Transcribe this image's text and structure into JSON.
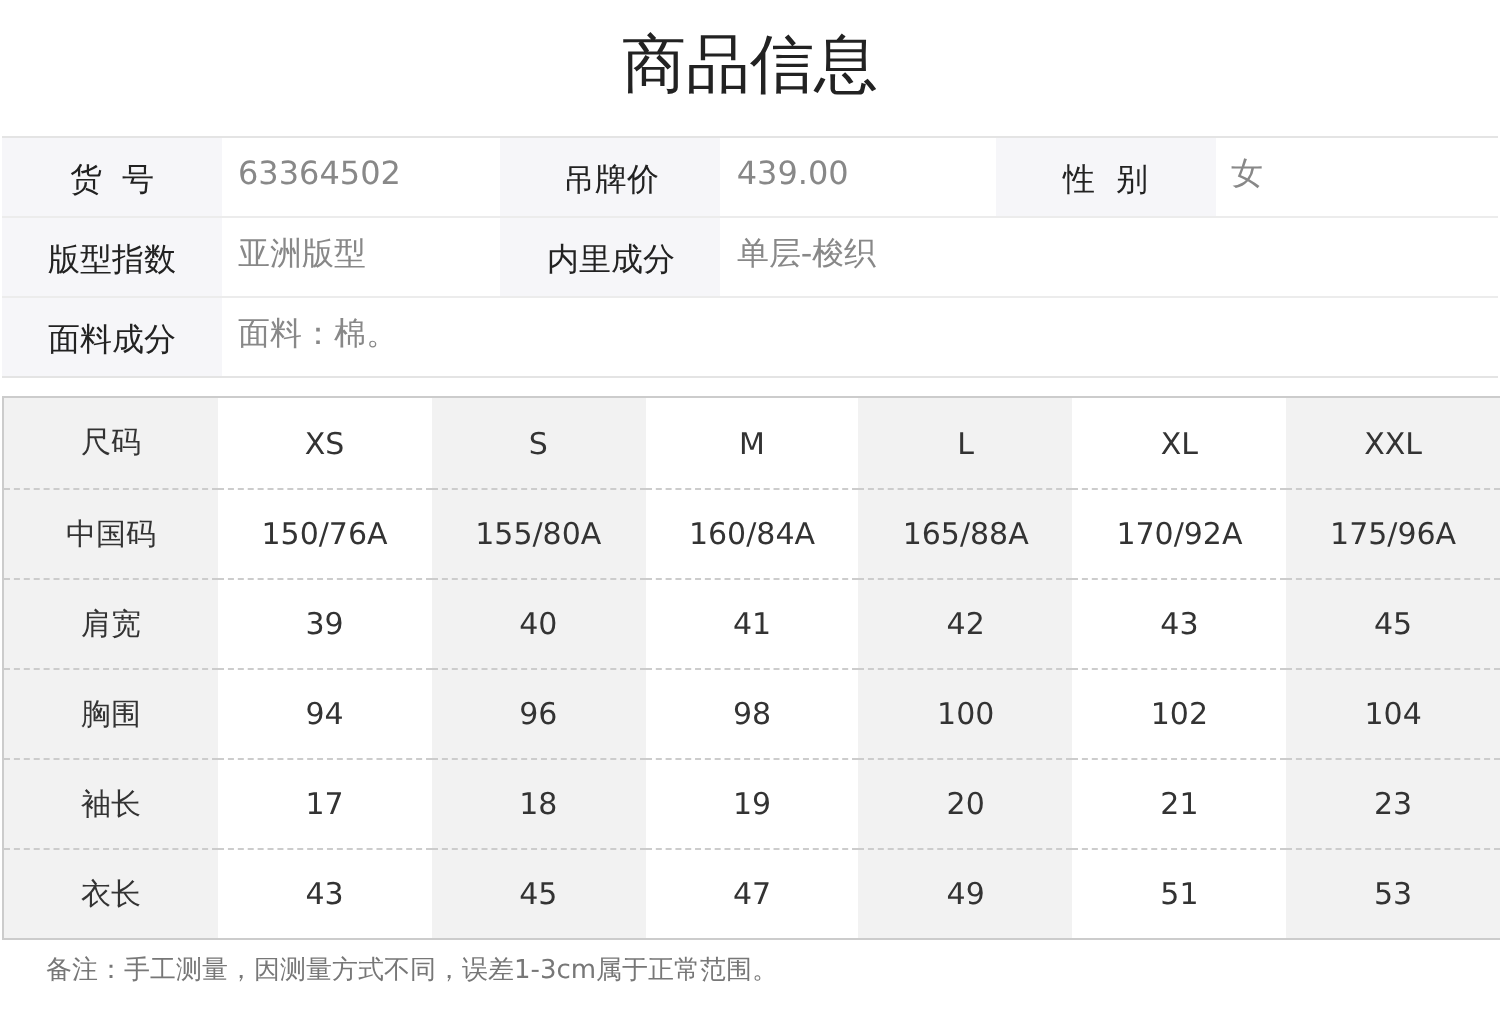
{
  "title": "商品信息",
  "info_rows": [
    {
      "fields": [
        {
          "label": "货  号",
          "value": "63364502"
        },
        {
          "label": "吊牌价",
          "value": "439.00"
        },
        {
          "label": "性  别",
          "value": "女"
        }
      ]
    },
    {
      "fields": [
        {
          "label": "版型指数",
          "value": "亚洲版型"
        },
        {
          "label": "内里成分",
          "value": "单层-梭织"
        }
      ]
    },
    {
      "fields": [
        {
          "label": "面料成分",
          "value": "面料：棉。"
        }
      ]
    }
  ],
  "size_table": {
    "columns": [
      "尺码",
      "XS",
      "S",
      "M",
      "L",
      "XL",
      "XXL"
    ],
    "rows": [
      [
        "中国码",
        "150/76A",
        "155/80A",
        "160/84A",
        "165/88A",
        "170/92A",
        "175/96A"
      ],
      [
        "肩宽",
        "39",
        "40",
        "41",
        "42",
        "43",
        "45"
      ],
      [
        "胸围",
        "94",
        "96",
        "98",
        "100",
        "102",
        "104"
      ],
      [
        "袖长",
        "17",
        "18",
        "19",
        "20",
        "21",
        "23"
      ],
      [
        "衣长",
        "43",
        "45",
        "47",
        "49",
        "51",
        "53"
      ]
    ]
  },
  "note": "备注：手工测量，因测量方式不同，误差1-3cm属于正常范围。"
}
